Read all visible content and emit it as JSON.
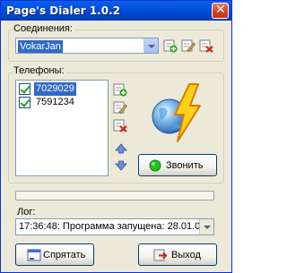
{
  "window": {
    "title": "Page's Dialer 1.0.2",
    "close_glyph": "✕"
  },
  "connections": {
    "group_label": "Соединения:",
    "selected": "VokarJan",
    "buttons": [
      "add-icon",
      "edit-icon",
      "delete-icon"
    ]
  },
  "phones": {
    "group_label": "Телефоны:",
    "items": [
      {
        "number": "7029029",
        "checked": true,
        "selected": true
      },
      {
        "number": "7591234",
        "checked": true,
        "selected": false
      }
    ],
    "call_button": "Звонить"
  },
  "log": {
    "label": "Лог:",
    "value": "17:36:48: Программа запущена: 28.01.0"
  },
  "footer": {
    "hide_button": "Спрятать",
    "exit_button": "Выход"
  },
  "colors": {
    "title_bar": "#0054e3",
    "selection": "#316ac5",
    "call_indicator": "#1ec41e",
    "window_bg": "#ece9d8"
  }
}
